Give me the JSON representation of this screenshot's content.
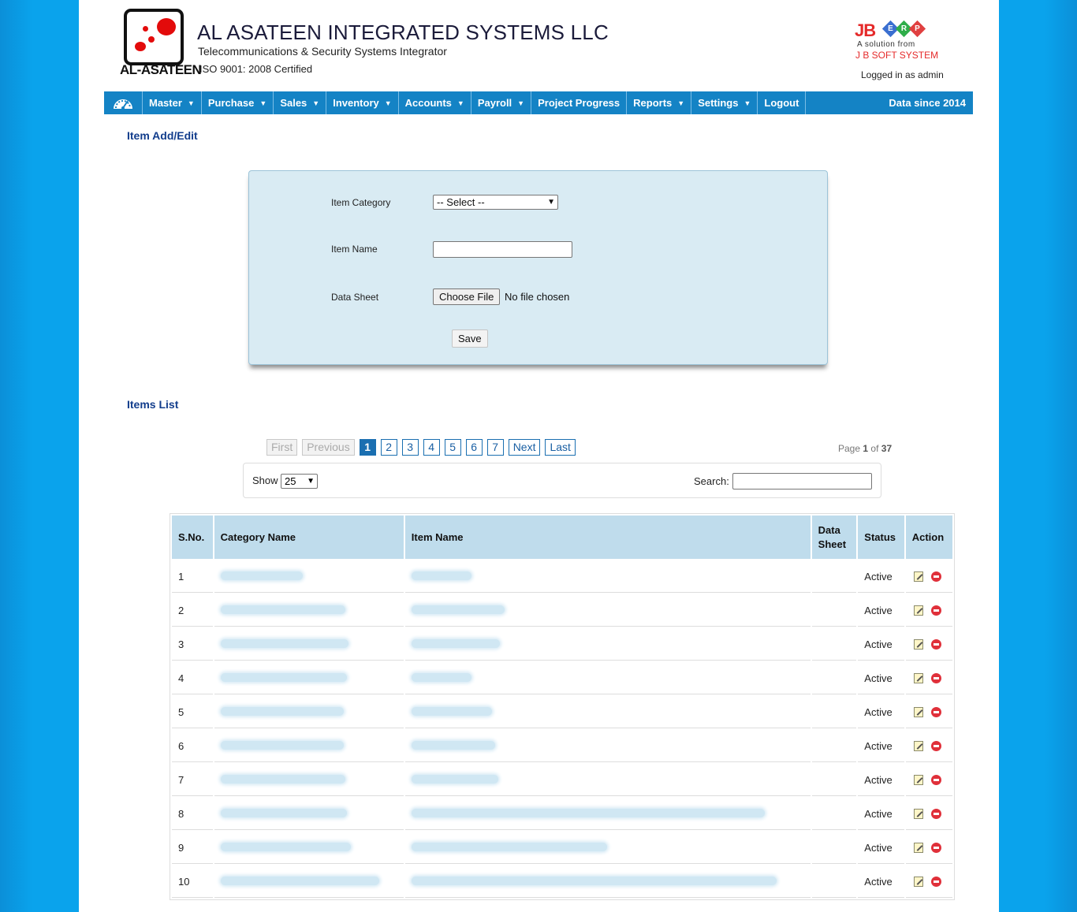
{
  "header": {
    "company_title": "AL ASATEEN INTEGRATED SYSTEMS LLC",
    "company_subtitle": "Telecommunications & Security Systems Integrator",
    "certification": "ISO 9001: 2008 Certified",
    "logo_text": "AL-ASATEEN",
    "erp_brand": "JB",
    "erp_letters": [
      "E",
      "R",
      "P"
    ],
    "erp_tagline": "A solution from",
    "erp_company": "J B SOFT SYSTEM",
    "logged_in": "Logged in as admin"
  },
  "nav": {
    "items": [
      {
        "label": "Master",
        "dropdown": true
      },
      {
        "label": "Purchase",
        "dropdown": true
      },
      {
        "label": "Sales",
        "dropdown": true
      },
      {
        "label": "Inventory",
        "dropdown": true
      },
      {
        "label": "Accounts",
        "dropdown": true
      },
      {
        "label": "Payroll",
        "dropdown": true
      },
      {
        "label": "Project Progress",
        "dropdown": false
      },
      {
        "label": "Reports",
        "dropdown": true
      },
      {
        "label": "Settings",
        "dropdown": true
      },
      {
        "label": "Logout",
        "dropdown": false
      }
    ],
    "right_text": "Data since 2014",
    "color": "#1483c5"
  },
  "form": {
    "section_title": "Item Add/Edit",
    "category_label": "Item Category",
    "category_value": "-- Select --",
    "name_label": "Item Name",
    "name_value": "",
    "datasheet_label": "Data Sheet",
    "file_button": "Choose File",
    "file_status": "No file chosen",
    "save_label": "Save"
  },
  "list": {
    "section_title": "Items List",
    "pagination": {
      "first": "First",
      "previous": "Previous",
      "pages": [
        "1",
        "2",
        "3",
        "4",
        "5",
        "6",
        "7"
      ],
      "current": "1",
      "next": "Next",
      "last": "Last",
      "page_info_prefix": "Page",
      "current_page": "1",
      "page_info_of": "of",
      "total_pages": "37"
    },
    "show_label": "Show",
    "show_value": "25",
    "search_label": "Search:",
    "columns": {
      "sno": "S.No.",
      "category": "Category Name",
      "item": "Item Name",
      "datasheet": "Data Sheet",
      "status": "Status",
      "action": "Action"
    },
    "rows": [
      {
        "sno": "1",
        "status": "Active"
      },
      {
        "sno": "2",
        "status": "Active"
      },
      {
        "sno": "3",
        "status": "Active"
      },
      {
        "sno": "4",
        "status": "Active"
      },
      {
        "sno": "5",
        "status": "Active"
      },
      {
        "sno": "6",
        "status": "Active"
      },
      {
        "sno": "7",
        "status": "Active"
      },
      {
        "sno": "8",
        "status": "Active"
      },
      {
        "sno": "9",
        "status": "Active"
      },
      {
        "sno": "10",
        "status": "Active"
      }
    ]
  }
}
